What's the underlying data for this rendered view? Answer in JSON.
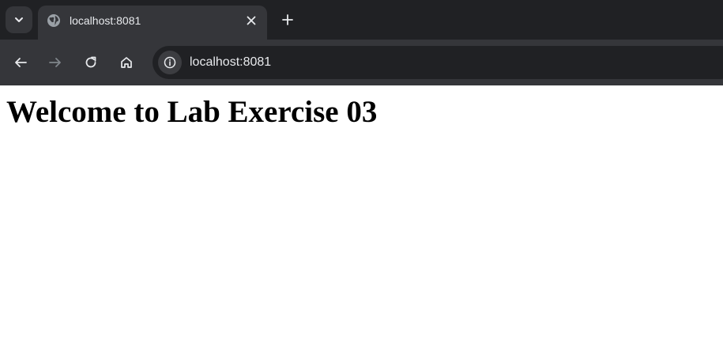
{
  "tab": {
    "title": "localhost:8081"
  },
  "toolbar": {
    "url": "localhost:8081"
  },
  "page": {
    "heading": "Welcome to Lab Exercise 03"
  },
  "icons": {
    "tab_search": "chevron-down-icon",
    "favicon": "globe-icon",
    "close": "close-icon",
    "new_tab": "plus-icon",
    "back": "arrow-left-icon",
    "forward": "arrow-right-icon",
    "reload": "reload-icon",
    "home": "home-icon",
    "site_info": "info-icon"
  },
  "colors": {
    "tabstrip_bg": "#202124",
    "toolbar_bg": "#35363a",
    "omnibox_bg": "#202124",
    "text_light": "#e8eaed",
    "page_bg": "#ffffff"
  }
}
